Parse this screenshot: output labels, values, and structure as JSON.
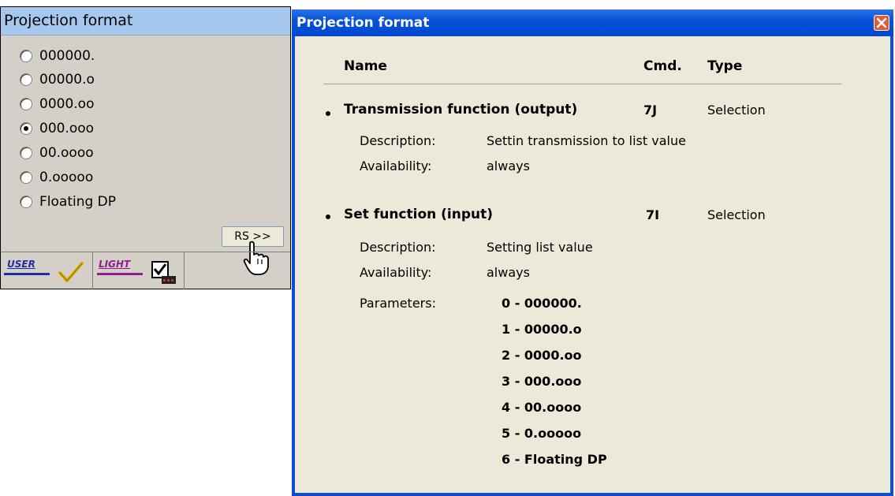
{
  "left_panel": {
    "title": "Projection format",
    "options": [
      {
        "label": "000000.",
        "checked": false
      },
      {
        "label": "00000.o",
        "checked": false
      },
      {
        "label": "0000.oo",
        "checked": false
      },
      {
        "label": "000.ooo",
        "checked": true
      },
      {
        "label": "00.oooo",
        "checked": false
      },
      {
        "label": "0.ooooo",
        "checked": false
      },
      {
        "label": "Floating DP",
        "checked": false
      }
    ],
    "rs_button": "RS >>",
    "user_label": "USER",
    "light_label": "LIGHT",
    "user_color": "#1c2fa8",
    "light_color": "#8e1e8e",
    "check_color": "#e0b000"
  },
  "help": {
    "title": "Projection format",
    "headers": {
      "name": "Name",
      "cmd": "Cmd.",
      "type": "Type"
    },
    "functions": [
      {
        "name": "Transmission function (output)",
        "cmd": "7J",
        "type": "Selection",
        "description_label": "Description:",
        "description": "Settin transmission to list value",
        "availability_label": "Availability:",
        "availability": "always"
      },
      {
        "name": "Set function (input)",
        "cmd": "7I",
        "type": "Selection",
        "description_label": "Description:",
        "description": "Setting list value",
        "availability_label": "Availability:",
        "availability": "always",
        "parameters_label": "Parameters:",
        "parameters": [
          "0 - 000000.",
          "1 - 00000.o",
          "2 - 0000.oo",
          "3 - 000.ooo",
          "4 - 00.oooo",
          "5 - 0.ooooo",
          "6 - Floating DP"
        ]
      }
    ]
  },
  "colors": {
    "titlebar": "#0553d8",
    "window_bg": "#ece9d8",
    "panel_bg": "#d4d0c8",
    "panel_title_bg": "#a6c8ee"
  }
}
